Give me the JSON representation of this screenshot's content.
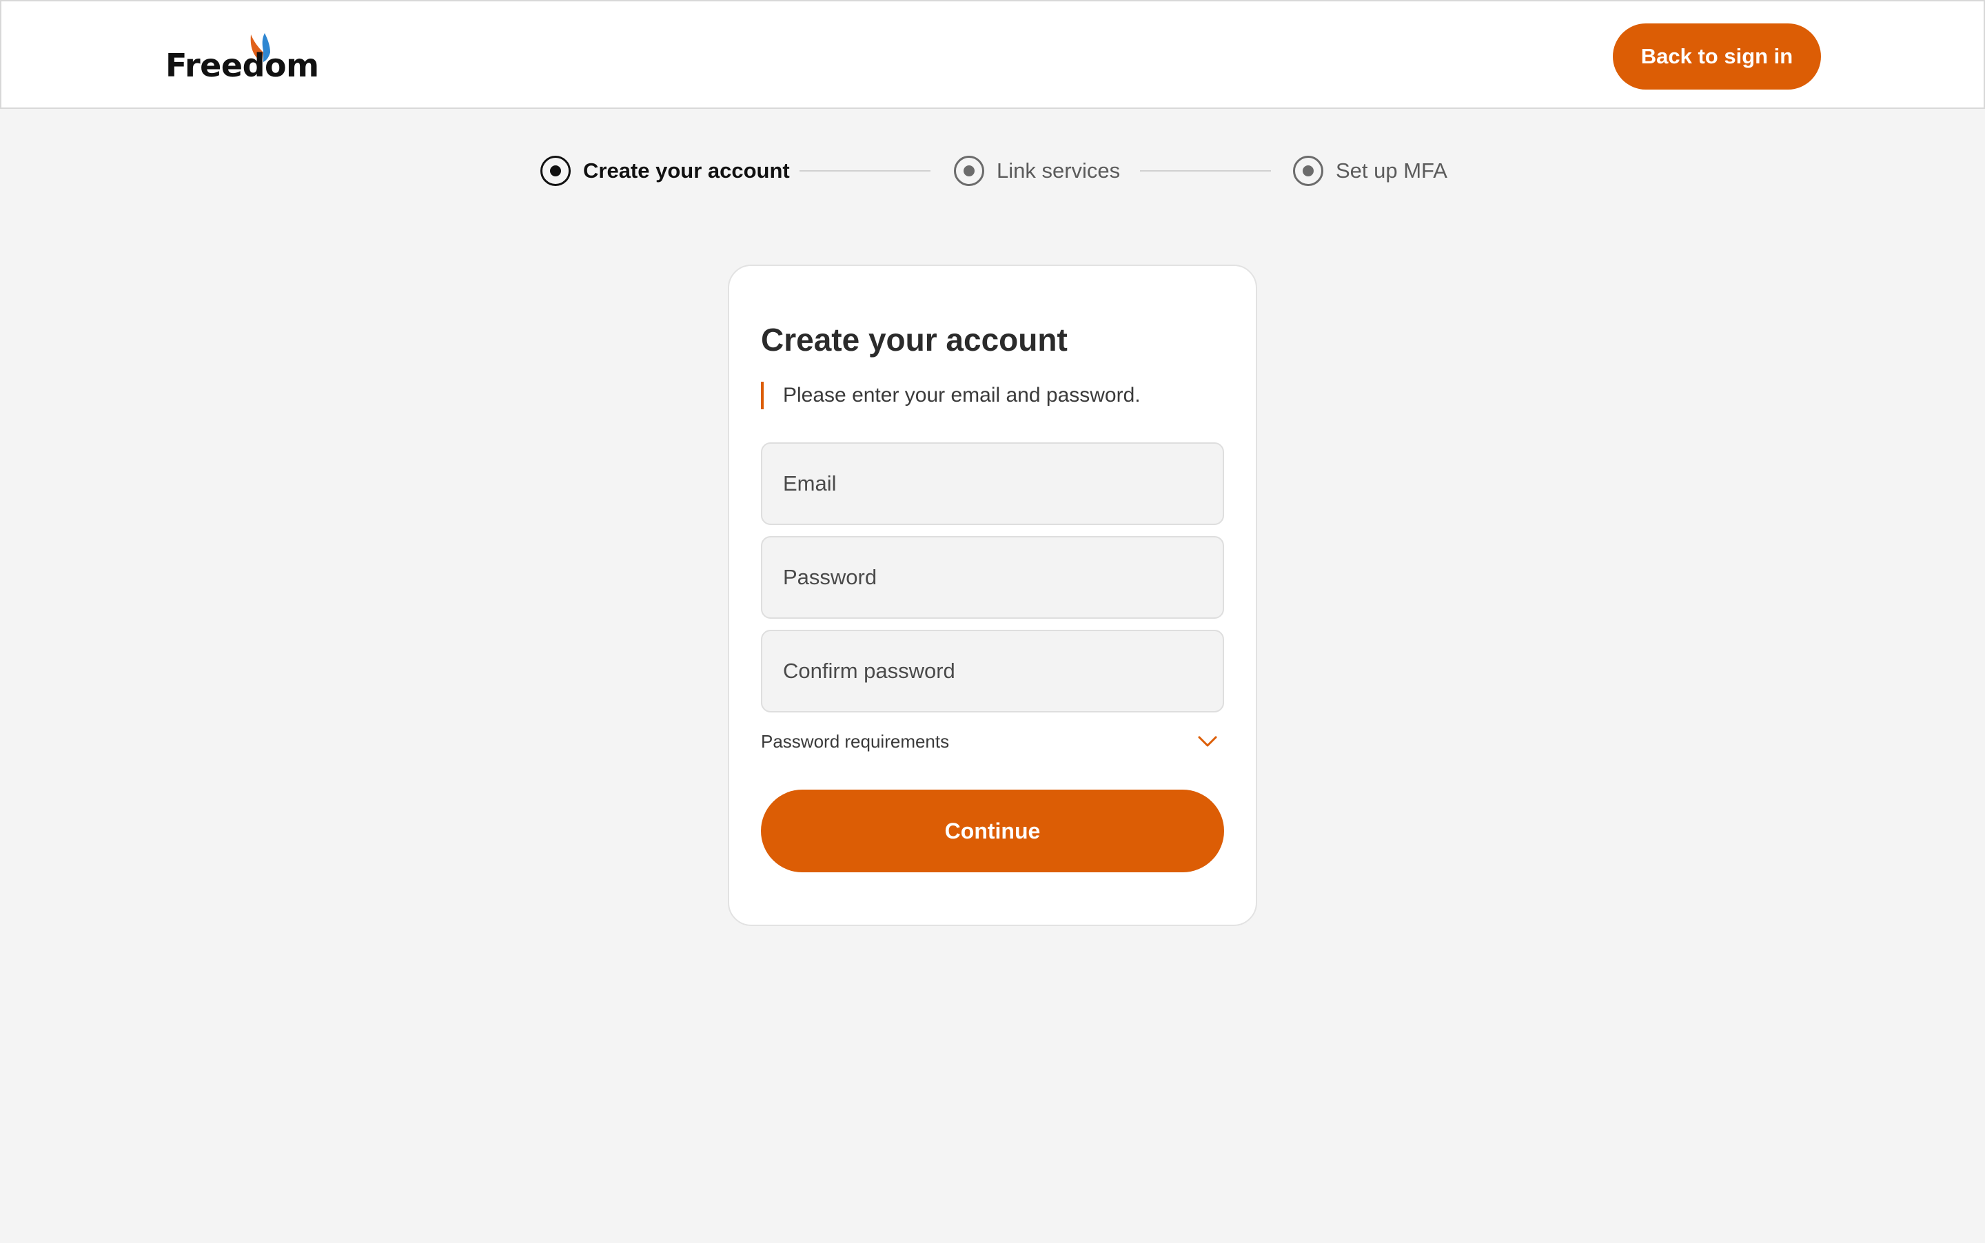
{
  "header": {
    "logo_text": "Freedom",
    "logo_tm": "™",
    "back_button_label": "Back to sign in"
  },
  "stepper": {
    "steps": [
      {
        "label": "Create your account",
        "state": "active"
      },
      {
        "label": "Link services",
        "state": "inactive"
      },
      {
        "label": "Set up MFA",
        "state": "inactive"
      }
    ]
  },
  "form": {
    "title": "Create your account",
    "instruction": "Please enter your email and password.",
    "email_placeholder": "Email",
    "password_placeholder": "Password",
    "confirm_placeholder": "Confirm password",
    "requirements_label": "Password requirements",
    "continue_label": "Continue"
  },
  "colors": {
    "accent": "#dc5d05",
    "background": "#f4f4f4",
    "card": "#ffffff",
    "logo_orange": "#e0601a",
    "logo_blue": "#2e86d1"
  },
  "icons": {
    "logo_mark": "wing-logo-icon",
    "step_indicator": "radio-icon",
    "requirements_toggle": "chevron-down-icon"
  }
}
